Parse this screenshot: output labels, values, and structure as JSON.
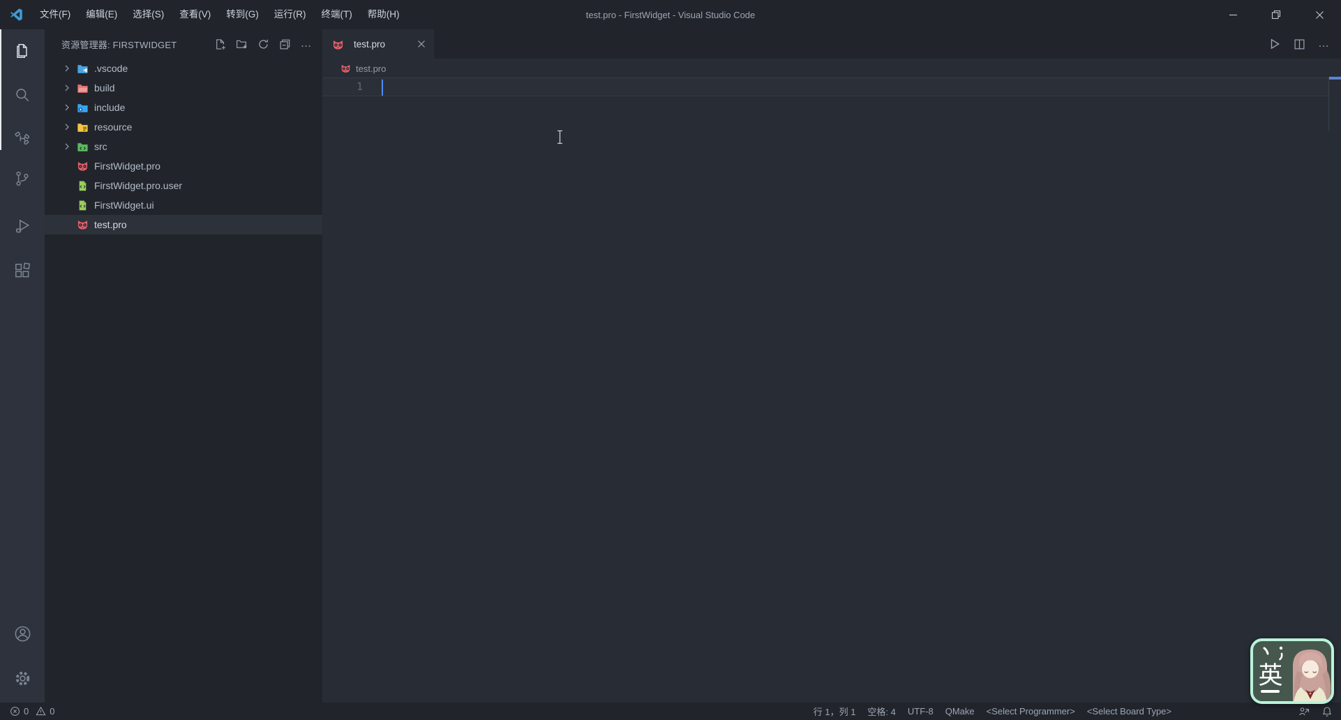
{
  "window": {
    "title": "test.pro - FirstWidget - Visual Studio Code"
  },
  "menu": {
    "items": [
      "文件(F)",
      "编辑(E)",
      "选择(S)",
      "查看(V)",
      "转到(G)",
      "运行(R)",
      "终端(T)",
      "帮助(H)"
    ]
  },
  "activity_bar": {
    "views": [
      "explorer",
      "search",
      "references",
      "source-control",
      "run-and-debug",
      "extensions"
    ],
    "bottom": [
      "account",
      "settings"
    ]
  },
  "explorer": {
    "title": "资源管理器: FIRSTWIDGET",
    "items": [
      {
        "label": ".vscode",
        "type": "folder",
        "badge": "vscode-logo",
        "color": "#4aa3e2",
        "expanded": false
      },
      {
        "label": "build",
        "type": "folder",
        "badge": "none",
        "color": "#e57373",
        "expanded": false
      },
      {
        "label": "include",
        "type": "folder",
        "badge": "plus-circle",
        "color": "#35a5ef",
        "expanded": false
      },
      {
        "label": "resource",
        "type": "folder",
        "badge": "lines",
        "color": "#f5c542",
        "expanded": false
      },
      {
        "label": "src",
        "type": "folder",
        "badge": "code",
        "color": "#5fb660",
        "expanded": false
      },
      {
        "label": "FirstWidget.pro",
        "type": "qmake-pro-file",
        "color": "#e2606b",
        "selected": false
      },
      {
        "label": "FirstWidget.pro.user",
        "type": "xml-file",
        "color": "#9acd5f",
        "selected": false
      },
      {
        "label": "FirstWidget.ui",
        "type": "xml-file",
        "color": "#9acd5f",
        "selected": false
      },
      {
        "label": "test.pro",
        "type": "qmake-pro-file",
        "color": "#e2606b",
        "selected": true
      }
    ]
  },
  "editor": {
    "tab_label": "test.pro",
    "breadcrumb": "test.pro",
    "line1_number": "1",
    "line1_content": "",
    "cursor": "line 1, column 1"
  },
  "status_bar": {
    "errors": "0",
    "warnings": "0",
    "cursor_position": "行 1，列 1",
    "indent": "空格: 4",
    "encoding": "UTF-8",
    "language": "QMake",
    "programmer": "<Select Programmer>",
    "board_type": "<Select Board Type>"
  },
  "ime": {
    "char": "英"
  },
  "icons": {
    "more": "…"
  },
  "colors": {
    "cursor": "#528bff",
    "accent_blue": "#5b83d6",
    "selected_row": "#2c313a",
    "ime_border": "#b9f3da",
    "ime_background": "#46584d",
    "pro_icon": "#e2606b",
    "xml_icon": "#9acd5f"
  }
}
